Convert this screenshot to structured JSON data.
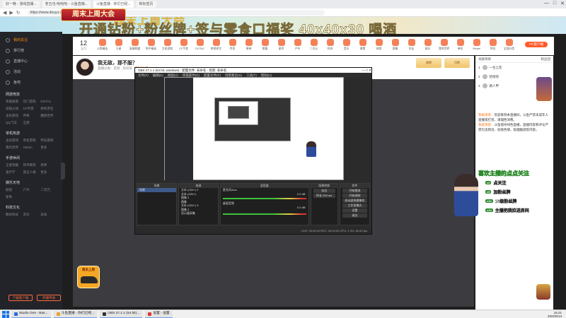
{
  "browser": {
    "tabs": [
      {
        "label": "好一晚 - 游戏直播...",
        "active": false
      },
      {
        "label": "老五也-哈哈哈 - 斗鱼直播...",
        "active": false
      },
      {
        "label": "斗鱼直播 - 你们已经...",
        "active": true
      },
      {
        "label": "新标签页",
        "active": false
      }
    ],
    "url": "https://www.douyu.com/",
    "window_controls": [
      "—",
      "□",
      "✕"
    ]
  },
  "banner": {
    "top_text": "周末上周大会",
    "main_text": "开通钻粉+粉丝牌+签与零食口福奖 40x40x30 喝酒",
    "event_logo": "周末上周大会"
  },
  "sidebar": {
    "items": [
      {
        "label": "我的关注",
        "active": true
      },
      {
        "label": "排行榜",
        "active": false
      },
      {
        "label": "直播中心",
        "active": false
      },
      {
        "label": "活动",
        "active": false
      },
      {
        "label": "鱼吧",
        "active": false
      }
    ],
    "sections": [
      {
        "title": "网游竞技",
        "entries": [
          "英雄联盟",
          "热门游戏",
          "DOTA2",
          "穿越火线",
          "CF手游",
          "绝地求生",
          "主机游戏",
          "传奇",
          "魔兽世界",
          "QQ飞车",
          "全部"
        ]
      },
      {
        "title": "单机热游",
        "entries": [
          "主机游戏",
          "单机游戏",
          "怀旧游戏",
          "我的世界",
          "Steam",
          "更多"
        ]
      },
      {
        "title": "手游休闲",
        "entries": [
          "王者荣耀",
          "和平精英",
          "原神",
          "金铲铲",
          "第五人格",
          "更多"
        ]
      },
      {
        "title": "娱乐天地",
        "entries": [
          "颜值",
          "户外",
          "二次元",
          "星秀"
        ]
      },
      {
        "title": "科技文化",
        "entries": [
          "数码科技",
          "音乐",
          "美食"
        ]
      }
    ],
    "buttons": [
      "下载客户端",
      "开播申请"
    ]
  },
  "navrow": {
    "date": "12",
    "date_sub": "五月",
    "items": [
      "斗鱼精选",
      "王者",
      "英雄联盟",
      "和平精英",
      "主机游戏",
      "CF手游",
      "DOTA2",
      "绝地求生",
      "传奇",
      "原神",
      "颜值",
      "星秀",
      "户外",
      "二次元",
      "科技",
      "音乐",
      "美食",
      "体育",
      "赛事",
      "车友",
      "娱乐",
      "我的世界",
      "单机",
      "Steam",
      "怀旧",
      "全部分类"
    ],
    "pc_button": "PC客户端"
  },
  "room": {
    "title": "我无敌，那不服？",
    "subtitle": "直播分类：其他 · 房间号 · ",
    "tag": "友好主播",
    "badges": [
      "周榜",
      "月榜"
    ]
  },
  "obs": {
    "title": "OBS 27.1.1 (64 bit, windows) - 配置文件: 未命名 - 场景: 未命名",
    "menu": [
      "文件(F)",
      "编辑(E)",
      "视图(V)",
      "停靠部件(D)",
      "配置文件(P)",
      "场景集合(S)",
      "工具(T)",
      "帮助(H)"
    ],
    "docks": [
      {
        "header": "场景",
        "rows": [
          "场景"
        ]
      },
      {
        "header": "来源",
        "rows": [
          "文本 (GDI+) 2",
          "文本 (GDI+)",
          "图像 2",
          "图像",
          "文本 (GDI+) 3",
          "图像 3",
          "显示器采集"
        ]
      },
      {
        "header": "混音器",
        "rows": [
          "麦克风/Aux",
          "0.0 dB",
          "桌面音频",
          "0.0 dB"
        ]
      },
      {
        "header": "场景转换",
        "rows": [
          "淡出",
          "时长 300 ms"
        ]
      },
      {
        "header": "控件",
        "rows": [
          "开始推流",
          "开始录制",
          "启动虚拟摄像机",
          "工作室模式",
          "设置",
          "退出"
        ]
      }
    ],
    "status": "LIVE: 00:00:00   REC: 00:00:00   CPU: 1.3%, 60.00 fps"
  },
  "watermark": {
    "label": "周末上周"
  },
  "right_panel": {
    "tabs": [
      "贡献周榜",
      "粉丝团"
    ],
    "ranks": [
      {
        "pos": "1",
        "name": "一生之友"
      },
      {
        "pos": "2",
        "name": "哈哈哈"
      },
      {
        "pos": "3",
        "name": "路人甲"
      }
    ],
    "chat": [
      {
        "name": "系统消息：",
        "text": "欢迎来到本直播间，斗鱼严禁未成年人直播或打赏，请理性消费。"
      },
      {
        "name": "系统消息：",
        "text": "斗鱼倡导绿色直播，直播内容和评论严禁包含政治、低俗色情、吸烟酗酒等内容。"
      }
    ],
    "follow": {
      "title": "喜欢主播的点点关注",
      "lines": [
        {
          "chip": "x2",
          "text": "点关注"
        },
        {
          "chip": "x5",
          "text": "加粉丝牌"
        },
        {
          "chip": "x10",
          "text": "15级粉丝牌"
        },
        {
          "chip": "x10",
          "text": "主播把我拉进房间"
        }
      ]
    }
  },
  "taskbar": {
    "tasks": [
      {
        "label": "Studio One - Bas...",
        "color": "#2a6ad8"
      },
      {
        "label": "斗鱼直播 - 你们已经...",
        "color": "#e8a32a"
      },
      {
        "label": "OBS 27.1.1 (64 bit)...",
        "color": "#333333"
      },
      {
        "label": "设置 - 设置",
        "color": "#d83a3a"
      }
    ],
    "time": "15:21",
    "date": "2022/5/13"
  }
}
